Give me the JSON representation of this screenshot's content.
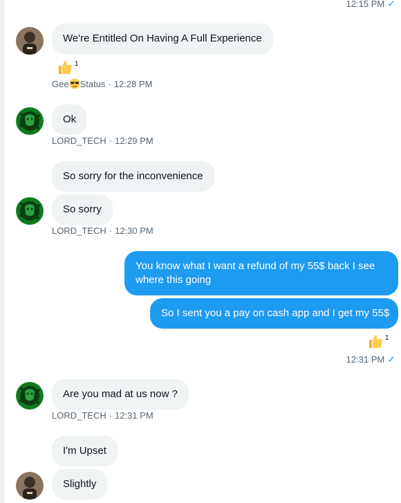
{
  "top_time": "12:15 PM",
  "colors": {
    "accent": "#1d9bf0",
    "incoming_bubble": "#eff3f4",
    "meta_text": "#536471"
  },
  "messages": [
    {
      "text": "We're Entitled On Having A Full Experience",
      "reaction_count": "1",
      "sender_left": "Gee",
      "sender_right": "Status",
      "time": "12:28 PM"
    },
    {
      "text": "Ok",
      "sender": "LORD_TECH",
      "time": "12:29 PM"
    },
    {
      "text": "So sorry for the inconvenience"
    },
    {
      "text": "So sorry",
      "sender": "LORD_TECH",
      "time": "12:30 PM"
    },
    {
      "text": "You know what I want a refund of my 55$ back I see where this going"
    },
    {
      "text": "So I sent you a pay on cash app and I get my 55$",
      "reaction_count": "1",
      "time": "12:31 PM"
    },
    {
      "text": "Are you mad at us now ?",
      "sender": "LORD_TECH",
      "time": "12:31 PM"
    },
    {
      "text": "I'm Upset"
    },
    {
      "text": "Slightly"
    }
  ],
  "separator": "·",
  "icons": {
    "read": "checkmark-icon",
    "reaction": "thumbs-up-icon",
    "emoji": "sunglasses-emoji-icon"
  }
}
